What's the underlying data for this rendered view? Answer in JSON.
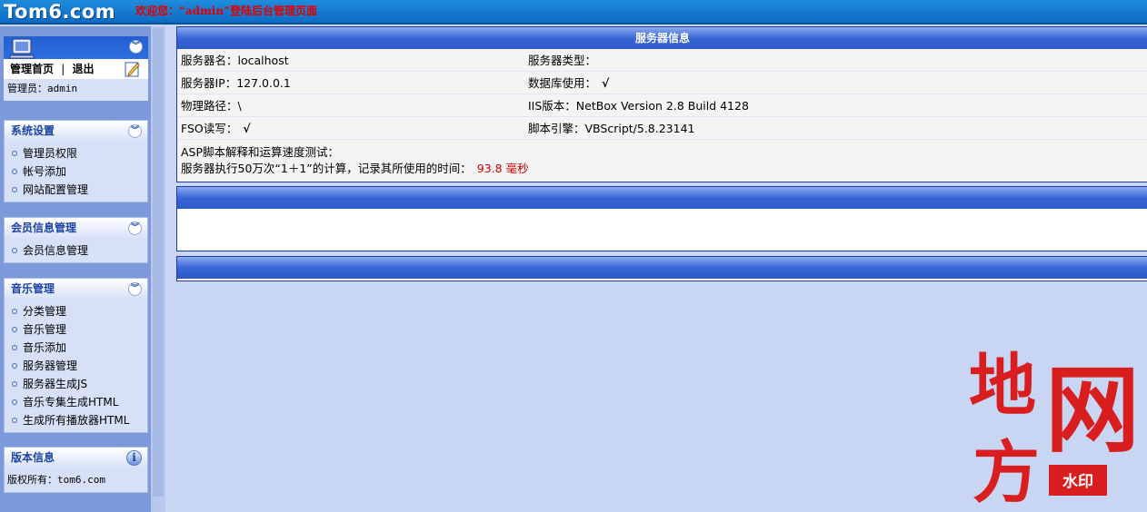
{
  "header": {
    "logo": "Tom6.com",
    "welcome": "欢迎您：“admin”登陆后台管理页面"
  },
  "admin": {
    "home_link": "管理首页",
    "separator": "|",
    "logout_link": "退出",
    "user_label": "管理员：admin"
  },
  "sections": [
    {
      "title": "系统设置",
      "items": [
        "管理员权限",
        "帐号添加",
        "网站配置管理"
      ]
    },
    {
      "title": "会员信息管理",
      "items": [
        "会员信息管理"
      ]
    },
    {
      "title": "音乐管理",
      "items": [
        "分类管理",
        "音乐管理",
        "音乐添加",
        "服务器管理",
        "服务器生成JS",
        "音乐专集生成HTML",
        "生成所有播放器HTML"
      ]
    }
  ],
  "version": {
    "title": "版本信息",
    "copyright": "版权所有：tom6.com"
  },
  "server_info": {
    "title": "服务器信息",
    "rows": [
      {
        "left": "服务器名：localhost",
        "right": "服务器类型："
      },
      {
        "left": "服务器IP：127.0.0.1",
        "right": "数据库使用：",
        "right_check": "√"
      },
      {
        "left": "物理路径：\\",
        "right": "IIS版本：NetBox Version 2.8 Build 4128"
      },
      {
        "left": "FSO读写：",
        "left_check": "√",
        "right": "脚本引擎：VBScript/5.8.23141"
      }
    ],
    "speed_title": "ASP脚本解释和运算速度测试：",
    "speed_text": "服务器执行50万次“1＋1”的计算，记录其所使用的时间：",
    "speed_value": "93.8 毫秒"
  },
  "watermark": {
    "chars": [
      "地",
      "方",
      "网"
    ],
    "tag": "水印",
    "color": "#d81e1e"
  }
}
